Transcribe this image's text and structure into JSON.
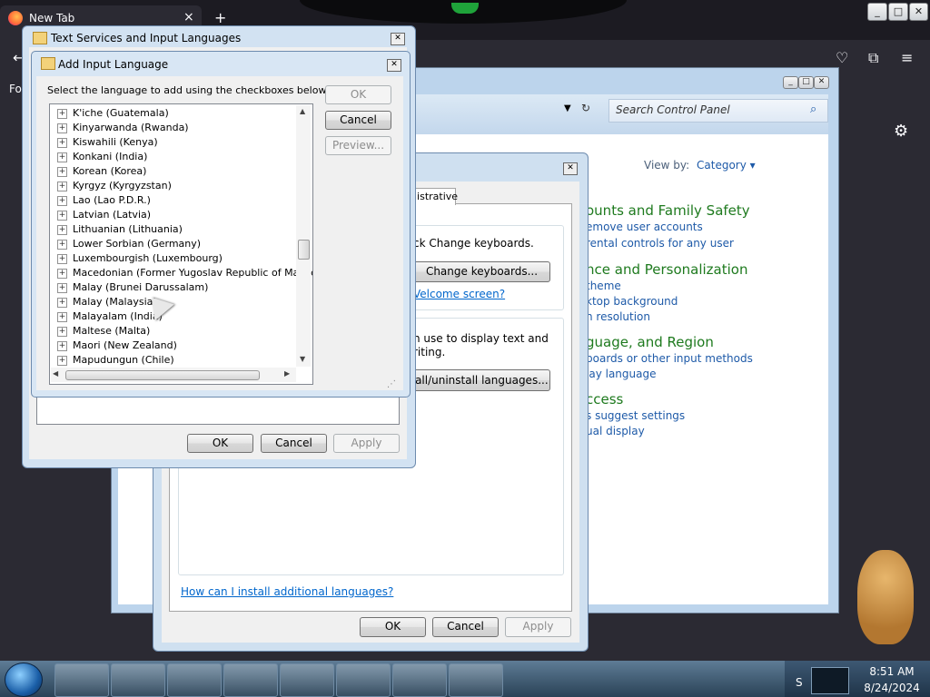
{
  "firefox": {
    "tab_title": "New Tab",
    "tab_close": "×",
    "new_tab": "+",
    "bookmark_text": "Fo",
    "toolbar_icons": [
      "pocket-icon",
      "extensions-icon",
      "menu-icon"
    ],
    "settings_icon": "gear-icon"
  },
  "control_panel": {
    "search_placeholder": "Search Control Panel",
    "view_by_label": "View by:",
    "view_by_value": "Category ▾",
    "categories": [
      {
        "heading": "ounts and Family Safety",
        "links": [
          "emove user accounts",
          "rental controls for any user"
        ]
      },
      {
        "heading": "nce and Personalization",
        "links": [
          "theme",
          "ktop background",
          "n resolution"
        ]
      },
      {
        "heading": "guage, and Region",
        "links": [
          "boards or other input methods",
          "lay language"
        ]
      },
      {
        "heading": "ccess",
        "links": [
          "s suggest settings",
          "ual display"
        ]
      }
    ]
  },
  "region_language": {
    "tab_label": "inistrative",
    "keyboards_text": "ck Change keyboards.",
    "change_keyboards_button": "Change keyboards...",
    "welcome_link": "Velcome screen?",
    "display_text_1": "n use to display text and",
    "display_text_2": "riting.",
    "install_button": "tall/uninstall languages...",
    "help_link": "How can I install additional languages?",
    "ok": "OK",
    "cancel": "Cancel",
    "apply": "Apply"
  },
  "text_services": {
    "title": "Text Services and Input Languages",
    "ok": "OK",
    "cancel": "Cancel",
    "apply": "Apply"
  },
  "add_input_language": {
    "title": "Add Input Language",
    "instruction": "Select the language to add using the checkboxes below.",
    "ok": "OK",
    "cancel": "Cancel",
    "preview": "Preview...",
    "languages": [
      "K'iche (Guatemala)",
      "Kinyarwanda (Rwanda)",
      "Kiswahili (Kenya)",
      "Konkani (India)",
      "Korean (Korea)",
      "Kyrgyz (Kyrgyzstan)",
      "Lao (Lao P.D.R.)",
      "Latvian (Latvia)",
      "Lithuanian (Lithuania)",
      "Lower Sorbian (Germany)",
      "Luxembourgish (Luxembourg)",
      "Macedonian (Former Yugoslav Republic of Macedon",
      "Malay (Brunei Darussalam)",
      "Malay (Malaysia)",
      "Malayalam (India)",
      "Maltese (Malta)",
      "Maori (New Zealand)",
      "Mapudungun (Chile)"
    ]
  },
  "taskbar": {
    "time": "8:51 AM",
    "date": "8/24/2024",
    "tray_label": "S"
  }
}
